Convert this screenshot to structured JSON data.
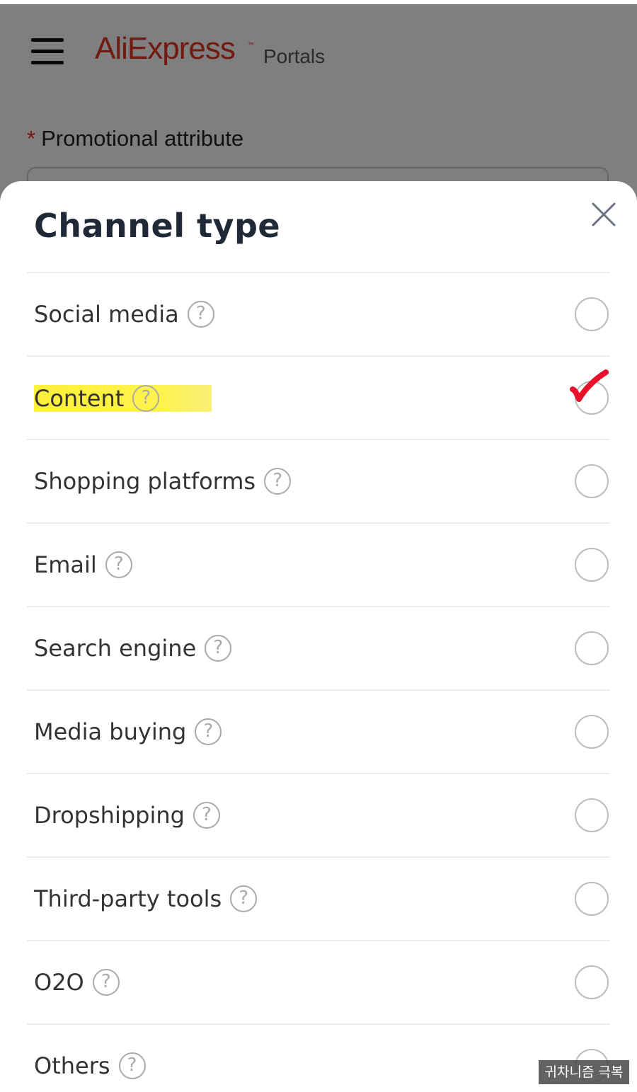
{
  "header": {
    "logo_text": "AliExpress",
    "logo_tm": "™",
    "subtitle": "Portals",
    "menu_icon": "hamburger-menu-icon",
    "brand_color": "#e43225"
  },
  "form": {
    "required_mark": "*",
    "field_label": "Promotional attribute"
  },
  "sheet": {
    "title": "Channel type",
    "close_icon": "close-icon",
    "help_glyph": "?",
    "options": [
      {
        "label": "Social media",
        "selected": false
      },
      {
        "label": "Content",
        "selected": true,
        "highlighted": true
      },
      {
        "label": "Shopping platforms",
        "selected": false
      },
      {
        "label": "Email",
        "selected": false
      },
      {
        "label": "Search engine",
        "selected": false
      },
      {
        "label": "Media buying",
        "selected": false
      },
      {
        "label": "Dropshipping",
        "selected": false
      },
      {
        "label": "Third-party tools",
        "selected": false
      },
      {
        "label": "O2O",
        "selected": false
      },
      {
        "label": "Others",
        "selected": false
      }
    ]
  },
  "annotation": {
    "checkmark_color": "#e8102a",
    "highlight_color": "#fff03a"
  },
  "watermark": {
    "text": "귀차니즘 극복"
  }
}
